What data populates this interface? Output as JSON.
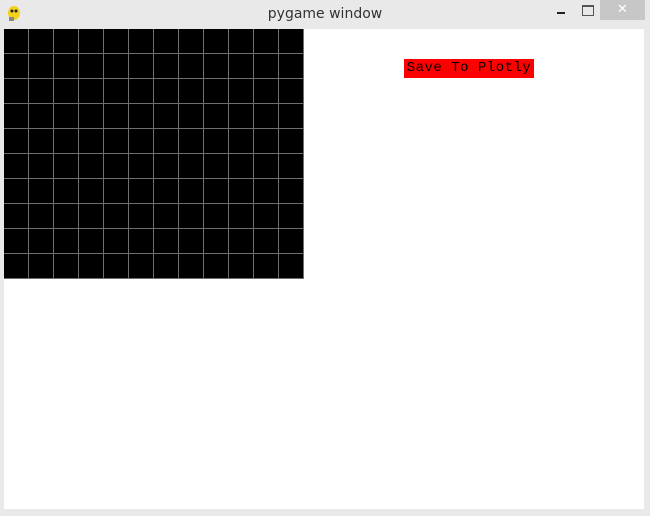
{
  "window": {
    "title": "pygame window",
    "close_glyph": "✕"
  },
  "grid": {
    "rows": 10,
    "cols": 12,
    "cell_color": "#000000",
    "line_color": "#6e6e6e"
  },
  "save_button": {
    "label": "Save To Plotly",
    "color": "#ff0000"
  }
}
